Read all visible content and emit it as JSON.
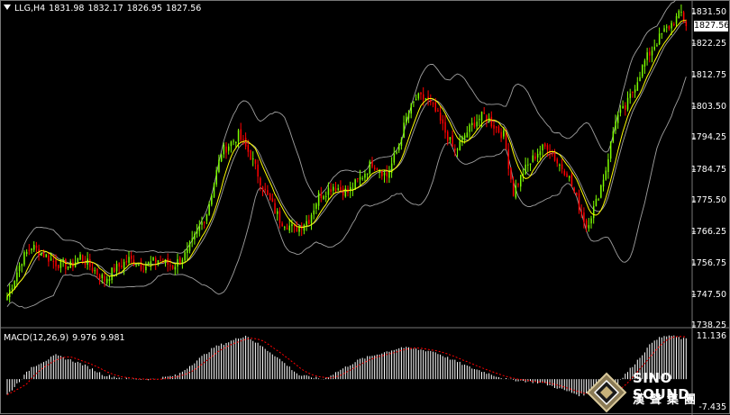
{
  "header": {
    "symbol": "LLG,H4",
    "open": "1831.98",
    "high": "1832.17",
    "low": "1826.95",
    "close": "1827.56"
  },
  "price_axis": [
    "1831.50",
    "1822.25",
    "1812.75",
    "1803.50",
    "1794.25",
    "1784.75",
    "1775.50",
    "1766.25",
    "1756.75",
    "1747.50",
    "1738.25"
  ],
  "current_price": "1827.56",
  "macd": {
    "label": "MACD(12,26,9)",
    "main": "9.976",
    "signal": "9.981",
    "axis_top": "11.136",
    "axis_bottom": "-7.435"
  },
  "logo": {
    "name_en": "SINO SOUND",
    "name_cn": "漢聲集團"
  },
  "colors": {
    "background": "#000000",
    "bull": "#7CFC00",
    "bear": "#FF0000",
    "ma": "#FFFF00",
    "bands": "#A0A0A0",
    "macd_hist": "#FFFFFF",
    "macd_signal": "#FF0000"
  },
  "chart_data": {
    "type": "candlestick",
    "title": "LLG,H4",
    "ylim": [
      1738.25,
      1834.0
    ],
    "anchors": [
      [
        0,
        1747
      ],
      [
        6,
        1758
      ],
      [
        10,
        1762
      ],
      [
        14,
        1760
      ],
      [
        20,
        1757
      ],
      [
        26,
        1756
      ],
      [
        30,
        1759
      ],
      [
        34,
        1756
      ],
      [
        40,
        1752
      ],
      [
        44,
        1755
      ],
      [
        50,
        1758
      ],
      [
        56,
        1756
      ],
      [
        62,
        1758
      ],
      [
        68,
        1756
      ],
      [
        74,
        1760
      ],
      [
        82,
        1772
      ],
      [
        88,
        1790
      ],
      [
        95,
        1795
      ],
      [
        100,
        1789
      ],
      [
        106,
        1778
      ],
      [
        112,
        1770
      ],
      [
        118,
        1767
      ],
      [
        124,
        1770
      ],
      [
        128,
        1777
      ],
      [
        134,
        1780
      ],
      [
        140,
        1778
      ],
      [
        146,
        1783
      ],
      [
        150,
        1787
      ],
      [
        156,
        1783
      ],
      [
        160,
        1790
      ],
      [
        164,
        1800
      ],
      [
        168,
        1806
      ],
      [
        172,
        1806
      ],
      [
        176,
        1802
      ],
      [
        180,
        1796
      ],
      [
        184,
        1790
      ],
      [
        188,
        1795
      ],
      [
        192,
        1799
      ],
      [
        196,
        1801
      ],
      [
        200,
        1798
      ],
      [
        204,
        1795
      ],
      [
        208,
        1778
      ],
      [
        212,
        1784
      ],
      [
        218,
        1790
      ],
      [
        222,
        1792
      ],
      [
        226,
        1787
      ],
      [
        230,
        1784
      ],
      [
        234,
        1776
      ],
      [
        238,
        1768
      ],
      [
        242,
        1775
      ],
      [
        246,
        1785
      ],
      [
        250,
        1800
      ],
      [
        254,
        1803
      ],
      [
        258,
        1810
      ],
      [
        262,
        1817
      ],
      [
        266,
        1822
      ],
      [
        270,
        1826
      ],
      [
        274,
        1829
      ],
      [
        277,
        1831.5
      ],
      [
        279,
        1827.56
      ]
    ],
    "macd_anchors": [
      [
        0,
        -4
      ],
      [
        10,
        3
      ],
      [
        20,
        6
      ],
      [
        30,
        4
      ],
      [
        40,
        1
      ],
      [
        50,
        0
      ],
      [
        60,
        0
      ],
      [
        70,
        1
      ],
      [
        85,
        8
      ],
      [
        98,
        11
      ],
      [
        110,
        6
      ],
      [
        120,
        1
      ],
      [
        130,
        0
      ],
      [
        145,
        5
      ],
      [
        162,
        8
      ],
      [
        175,
        7
      ],
      [
        190,
        3
      ],
      [
        205,
        0
      ],
      [
        220,
        -1
      ],
      [
        235,
        -4
      ],
      [
        248,
        -3
      ],
      [
        258,
        4
      ],
      [
        266,
        10
      ],
      [
        272,
        11
      ],
      [
        279,
        10
      ]
    ]
  }
}
